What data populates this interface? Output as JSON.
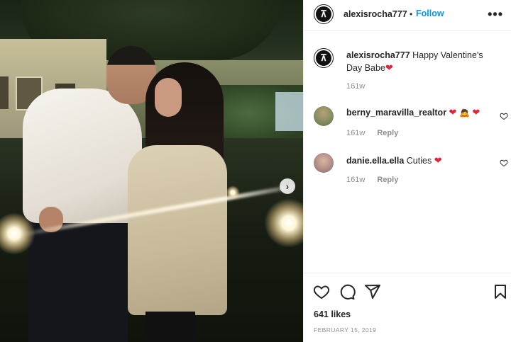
{
  "post": {
    "author": "alexisrocha777",
    "follow_label": "Follow",
    "separator": "•",
    "more_label": "•••",
    "caption_text": "Happy Valentine's Day Babe",
    "caption_emoji": "❤",
    "caption_time": "161w",
    "carousel_next": "›"
  },
  "comments": [
    {
      "username": "berny_maravilla_realtor",
      "text": "",
      "emojis": [
        "❤",
        "🙇",
        "❤"
      ],
      "time": "161w",
      "reply_label": "Reply"
    },
    {
      "username": "danie.ella.ella",
      "text": "Cuties",
      "emojis": [
        "❤"
      ],
      "time": "161w",
      "reply_label": "Reply"
    }
  ],
  "footer": {
    "likes": "641 likes",
    "date": "FEBRUARY 15, 2019"
  },
  "icons": {
    "like": "heart-icon",
    "comment": "comment-icon",
    "share": "send-icon",
    "save": "bookmark-icon",
    "more": "more-options-icon",
    "next": "chevron-right-icon"
  },
  "colors": {
    "follow": "#0095f6",
    "heart_emoji": "#e0243c",
    "muted_text": "#8e8e8e",
    "text": "#262626"
  }
}
